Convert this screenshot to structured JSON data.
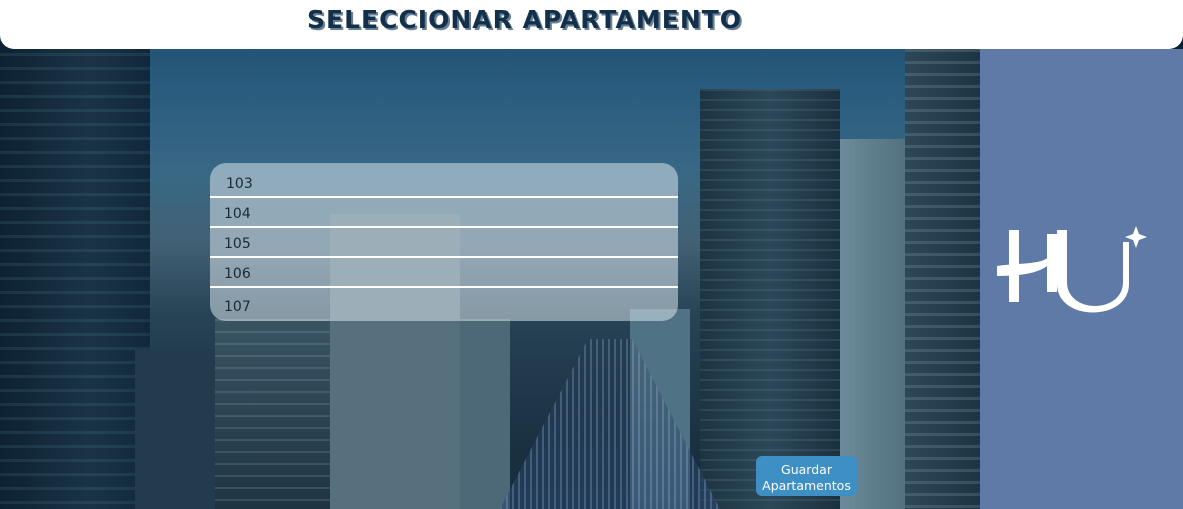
{
  "header": {
    "title": "SELECCIONAR APARTAMENTO"
  },
  "apartments": {
    "items": [
      {
        "label": "103"
      },
      {
        "label": "104"
      },
      {
        "label": "105"
      },
      {
        "label": "106"
      },
      {
        "label": "107"
      }
    ]
  },
  "actions": {
    "save_label": "Guardar Apartamentos"
  },
  "brand": {
    "logo_name": "hu-logo-icon"
  },
  "colors": {
    "header_bg": "#ffffff",
    "title": "#12304a",
    "side_panel": "#5f7aa6",
    "button": "#3d8fc4",
    "list_bg": "#d7e4eb"
  }
}
